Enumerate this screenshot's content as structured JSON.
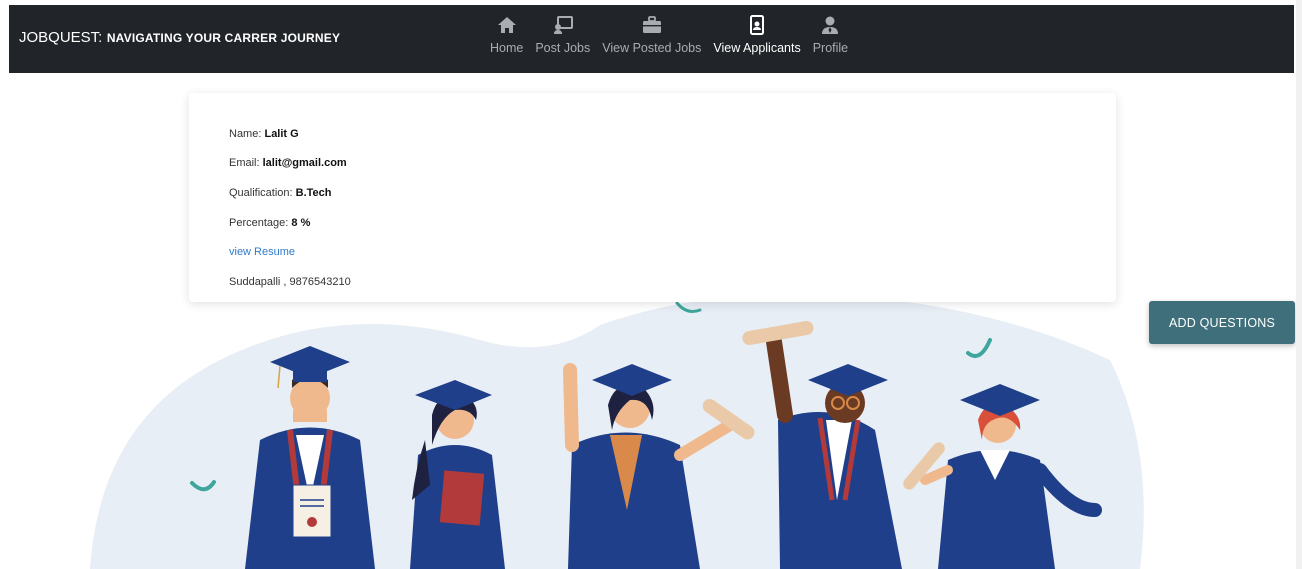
{
  "navbar": {
    "brand_main": "JOBQUEST:",
    "brand_sub": "NAVIGATING YOUR CARRER JOURNEY",
    "items": [
      {
        "label": "Home",
        "icon": "home-icon"
      },
      {
        "label": "Post Jobs",
        "icon": "chalkboard-teacher-icon"
      },
      {
        "label": "View Posted Jobs",
        "icon": "briefcase-icon"
      },
      {
        "label": "View Applicants",
        "icon": "id-badge-icon",
        "active": true
      },
      {
        "label": "Profile",
        "icon": "user-tie-icon"
      }
    ]
  },
  "applicant": {
    "name_label": "Name:",
    "name": "Lalit G",
    "email_label": "Email:",
    "email": "lalit@gmail.com",
    "qualification_label": "Qualification:",
    "qualification": "B.Tech",
    "percentage_label": "Percentage:",
    "percentage": "8 %",
    "resume_link": "view Resume",
    "address_phone": "Suddapalli , 9876543210"
  },
  "actions": {
    "add_questions": "ADD QUESTIONS"
  },
  "colors": {
    "navbar_bg": "#212529",
    "button_bg": "#3f6f7a",
    "link": "#2f7bc8",
    "gown": "#1f3f8a",
    "blob": "#e8eef5"
  }
}
